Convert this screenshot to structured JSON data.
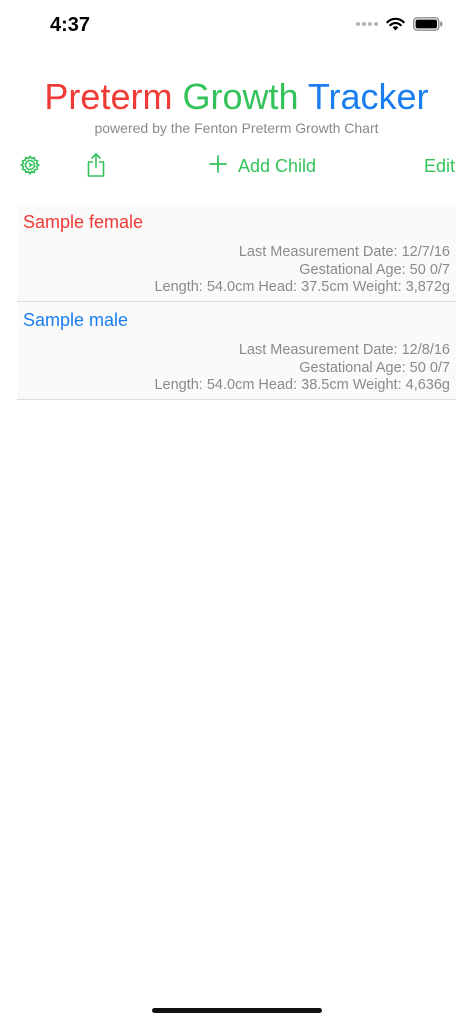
{
  "status_bar": {
    "time": "4:37"
  },
  "header": {
    "title_word_1": "Preterm",
    "title_word_2": "Growth",
    "title_word_3": "Tracker",
    "subtitle": "powered by the Fenton Preterm Growth Chart"
  },
  "toolbar": {
    "add_label": "Add Child",
    "edit_label": "Edit"
  },
  "children": [
    {
      "name": "Sample female",
      "last_measurement": "Last Measurement Date: 12/7/16",
      "gestational_age": "Gestational Age: 50 0/7",
      "measurements": "Length: 54.0cm Head: 37.5cm Weight: 3,872g"
    },
    {
      "name": "Sample male",
      "last_measurement": "Last Measurement Date: 12/8/16",
      "gestational_age": "Gestational Age: 50 0/7",
      "measurements": "Length: 54.0cm Head: 38.5cm Weight: 4,636g"
    }
  ],
  "colors": {
    "red": "#f03a35",
    "green": "#34c25a",
    "blue": "#1a7df0",
    "gray_text": "#8a8a8e"
  },
  "icons": [
    "gear-icon",
    "share-icon",
    "plus-icon",
    "wifi-icon",
    "battery-icon"
  ]
}
